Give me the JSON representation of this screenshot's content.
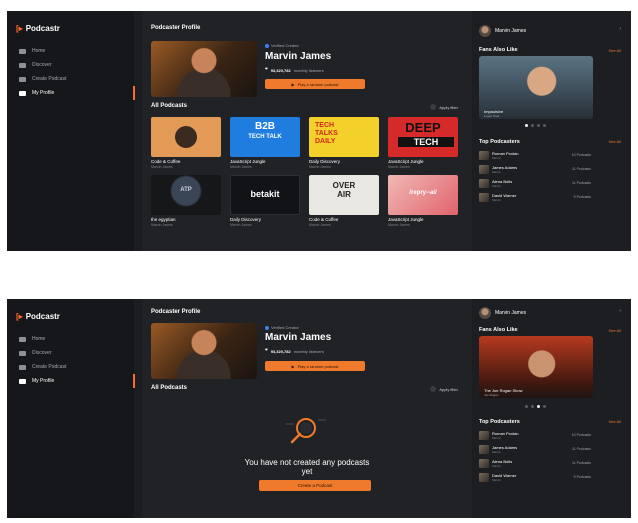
{
  "brand": "Podcastr",
  "nav": [
    "Home",
    "Discover",
    "Create Podcast",
    "My Profile"
  ],
  "profile": {
    "section_title": "Podcaster Profile",
    "verified": "Verified Creator",
    "name": "Marvin James",
    "listeners_count": "93,320,782",
    "listeners_label": "monthly listeners",
    "cta": "Play a random podcast"
  },
  "all_podcasts": {
    "title": "All Podcasts",
    "filter": "Apply filter"
  },
  "podcasts": [
    {
      "title": "Code & Coffee",
      "subtitle": "Marvin James",
      "art": "CODE"
    },
    {
      "title": "JavaScript Jungle",
      "subtitle": "Marvin James",
      "art": "B2B TECH TALK"
    },
    {
      "title": "Daily Discovery",
      "subtitle": "Marvin James",
      "art": "TECH TALKS DAILY"
    },
    {
      "title": "JavaScript Jungle",
      "subtitle": "Marvin James",
      "art": "DEEP TECH"
    },
    {
      "title": "the egyptian",
      "subtitle": "Marvin James",
      "art": "ATP"
    },
    {
      "title": "Daily Discovery",
      "subtitle": "Marvin James",
      "art": "betakit"
    },
    {
      "title": "Code & Coffee",
      "subtitle": "Marvin James",
      "art": "OVER THE AIR"
    },
    {
      "title": "JavaScript Jungle",
      "subtitle": "Marvin James",
      "art": "/repry--ai/"
    }
  ],
  "empty": {
    "message": "You have not created any podcasts yet",
    "button": "Create a Podcast"
  },
  "user": {
    "name": "Marvin James"
  },
  "fans": {
    "title": "Fans Also Like",
    "see_all": "See All",
    "card1_title": "Impaulsive",
    "card1_sub": "Logan Paul",
    "card2_title": "The Joe Rogan Show",
    "card2_sub": "Joe Rogan"
  },
  "top": {
    "title": "Top Podcasters",
    "see_all": "See All",
    "items": [
      {
        "name": "Roman Poolan",
        "sub": "Marvin",
        "count": "10 Podcasts"
      },
      {
        "name": "James Adams",
        "sub": "Marvin",
        "count": "11 Podcasts"
      },
      {
        "name": "Alena Botis",
        "sub": "Marvin",
        "count": "11 Podcasts"
      },
      {
        "name": "David Warner",
        "sub": "Marvin",
        "count": "9 Podcasts"
      }
    ]
  },
  "colors": {
    "accent": "#f07a2b",
    "bg": "#1c1d21"
  }
}
